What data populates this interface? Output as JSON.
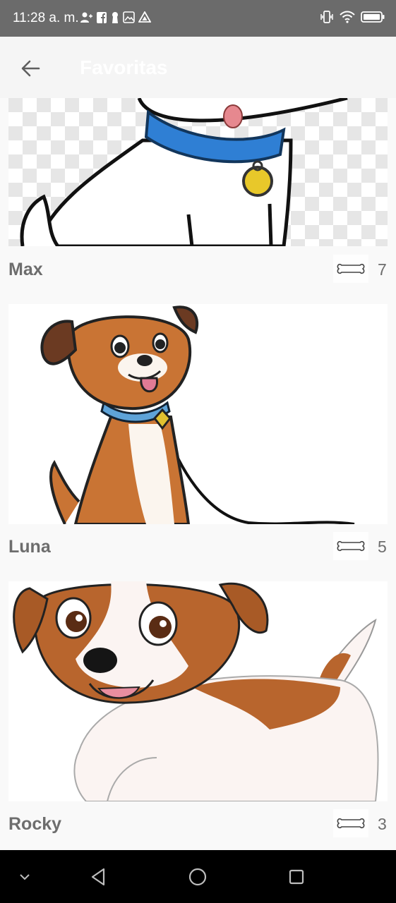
{
  "status_bar": {
    "time": "11:28 a. m.",
    "left_icons": [
      "person-add-icon",
      "facebook-icon",
      "keyhole-icon",
      "gallery-icon",
      "drive-icon"
    ],
    "right_icons": [
      "vibrate-icon",
      "wifi-icon",
      "battery-icon"
    ]
  },
  "app_bar": {
    "title": "Favoritas",
    "back_icon": "arrow-back-icon"
  },
  "pets": [
    {
      "name": "Max",
      "likes": "7",
      "like_icon": "bone-icon"
    },
    {
      "name": "Luna",
      "likes": "5",
      "like_icon": "bone-icon"
    },
    {
      "name": "Rocky",
      "likes": "3",
      "like_icon": "bone-icon"
    }
  ],
  "nav_bar": {
    "icons": [
      "chevron-down-icon",
      "back-triangle-icon",
      "home-circle-icon",
      "recents-square-icon"
    ]
  },
  "colors": {
    "status_bar": "#6b6b6b",
    "app_bar": "#f5f5f5",
    "background": "#f9f9f9",
    "pet_name": "#6d6d6d",
    "nav_bar": "#000000"
  }
}
